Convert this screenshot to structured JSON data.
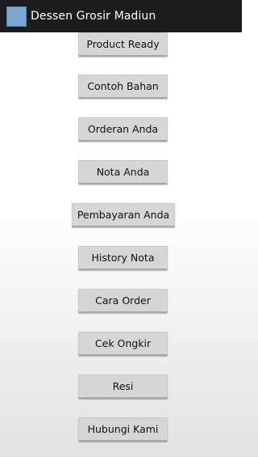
{
  "app": {
    "title": "Dessen Grosir Madiun",
    "icon": "app-logo-icon"
  },
  "menu": [
    {
      "label": "Product Ready"
    },
    {
      "label": "Contoh Bahan"
    },
    {
      "label": "Orderan Anda"
    },
    {
      "label": "Nota Anda"
    },
    {
      "label": "Pembayaran Anda"
    },
    {
      "label": "History Nota"
    },
    {
      "label": "Cara Order"
    },
    {
      "label": "Cek Ongkir"
    },
    {
      "label": "Resi"
    },
    {
      "label": "Hubungi Kami"
    }
  ]
}
